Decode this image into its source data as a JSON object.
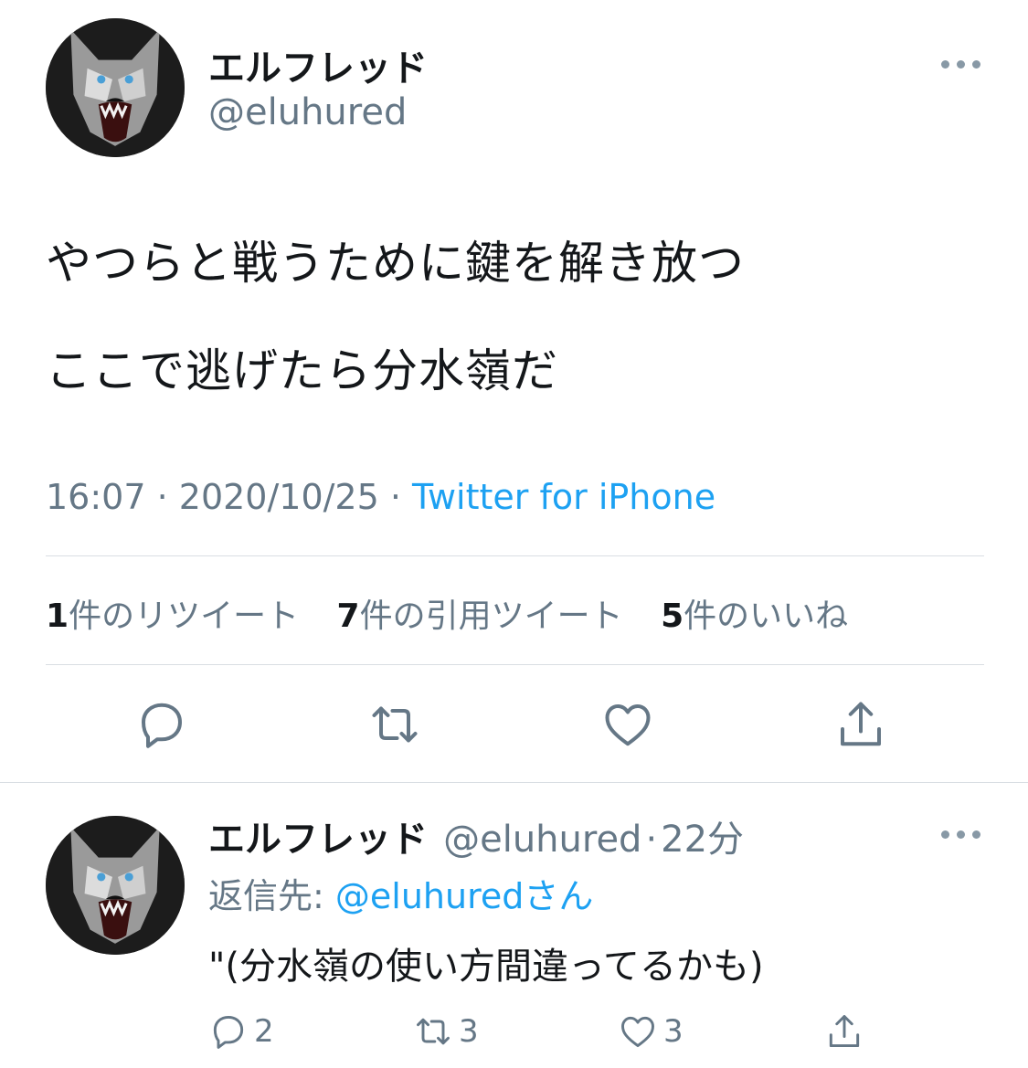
{
  "tweet": {
    "author": {
      "display_name": "エルフレッド",
      "handle": "@eluhured"
    },
    "lines": [
      "やつらと戦うために鍵を解き放つ",
      "ここで逃げたら分水嶺だ"
    ],
    "time": "16:07",
    "date": "2020/10/25",
    "source": "Twitter for iPhone",
    "separator": " · ",
    "stats": {
      "retweets": {
        "count": "1",
        "label": "件のリツイート"
      },
      "quotes": {
        "count": "7",
        "label": "件の引用ツイート"
      },
      "likes": {
        "count": "5",
        "label": "件のいいね"
      }
    },
    "actions": [
      "reply-icon",
      "retweet-icon",
      "like-icon",
      "share-icon"
    ]
  },
  "reply": {
    "author": {
      "display_name": "エルフレッド",
      "handle": "@eluhured"
    },
    "separator": "·",
    "age": "22分",
    "replying_label": "返信先: ",
    "replying_to": "@eluhuredさん",
    "text": "\"(分水嶺の使い方間違ってるかも)",
    "counts": {
      "replies": "2",
      "retweets": "3",
      "likes": "3"
    }
  },
  "colors": {
    "link": "#1da1f2",
    "secondary": "#657786",
    "text": "#14171a",
    "divider": "#d9dee3"
  }
}
